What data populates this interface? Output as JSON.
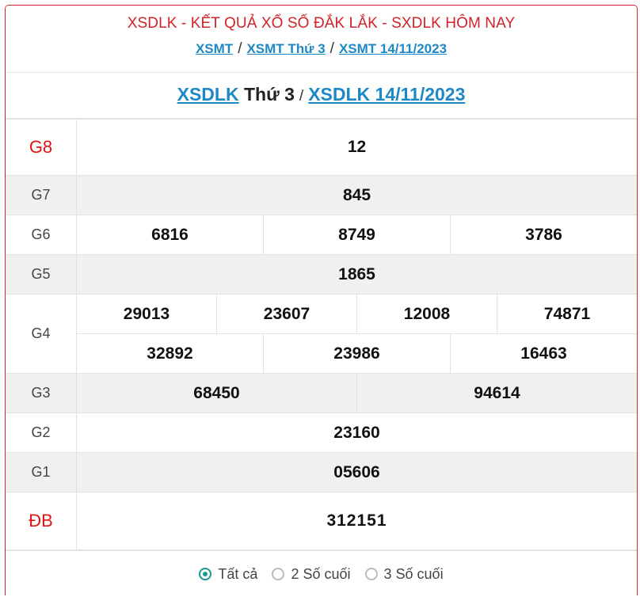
{
  "header": {
    "title": "XSDLK - KẾT QUẢ XỔ SỐ ĐẮK LẮK - SXDLK HÔM NAY",
    "crumbs": [
      "XSMT",
      "XSMT Thứ 3",
      "XSMT 14/11/2023"
    ],
    "separator": "/"
  },
  "subhead": {
    "link1": "XSDLK",
    "plain": "Thứ 3",
    "separator": "/",
    "link2": "XSDLK 14/11/2023"
  },
  "prizes": {
    "g8": {
      "label": "G8",
      "numbers": [
        "12"
      ]
    },
    "g7": {
      "label": "G7",
      "numbers": [
        "845"
      ]
    },
    "g6": {
      "label": "G6",
      "numbers": [
        "6816",
        "8749",
        "3786"
      ]
    },
    "g5": {
      "label": "G5",
      "numbers": [
        "1865"
      ]
    },
    "g4": {
      "label": "G4",
      "numbers": [
        "29013",
        "23607",
        "12008",
        "74871",
        "32892",
        "23986",
        "16463"
      ]
    },
    "g3": {
      "label": "G3",
      "numbers": [
        "68450",
        "94614"
      ]
    },
    "g2": {
      "label": "G2",
      "numbers": [
        "23160"
      ]
    },
    "g1": {
      "label": "G1",
      "numbers": [
        "05606"
      ]
    },
    "db": {
      "label": "ĐB",
      "numbers": [
        "312151"
      ]
    }
  },
  "filters": {
    "options": [
      "Tất cả",
      "2 Số cuối",
      "3 Số cuối"
    ],
    "selected": "Tất cả"
  },
  "colors": {
    "accent_red": "#e31313",
    "link_blue": "#1e88c7",
    "radio_active": "#1a9a8e"
  }
}
